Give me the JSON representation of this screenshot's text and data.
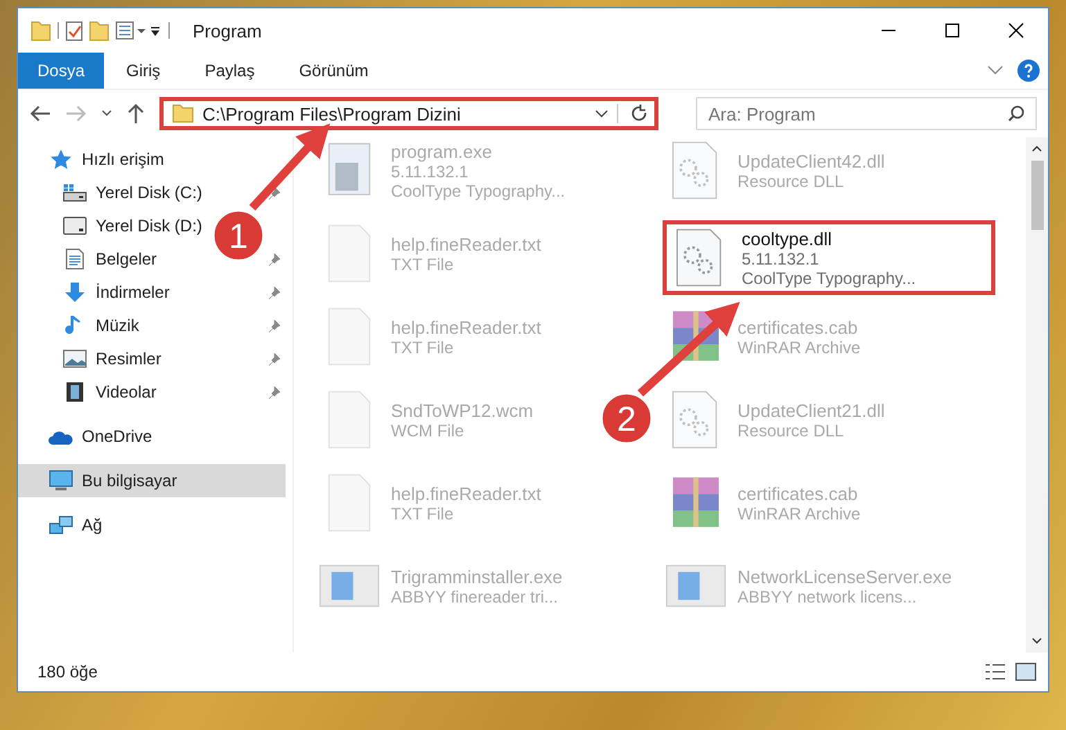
{
  "window": {
    "title": "Program",
    "controls": [
      {
        "kind": "minimize"
      },
      {
        "kind": "maximize"
      },
      {
        "kind": "close"
      }
    ]
  },
  "ribbon": {
    "tabs": [
      {
        "label": "Dosya",
        "selected": true
      },
      {
        "label": "Giriş",
        "selected": false
      },
      {
        "label": "Paylaş",
        "selected": false
      },
      {
        "label": "Görünüm",
        "selected": false
      }
    ]
  },
  "address": {
    "path": "C:\\Program Files\\Program Dizini",
    "highlighted": true
  },
  "search": {
    "placeholder": "Ara: Program"
  },
  "sidebar": {
    "items": [
      {
        "label": "Hızlı erişim",
        "kind": "star",
        "selected": false,
        "children": [
          {
            "label": "Yerel Disk (C:)",
            "kind": "system-drive",
            "pinned": true
          },
          {
            "label": "Yerel Disk (D:)",
            "kind": "drive"
          },
          {
            "label": "Belgeler",
            "kind": "document",
            "pinned": true
          },
          {
            "label": "İndirmeler",
            "kind": "download",
            "pinned": true
          },
          {
            "label": "Müzik",
            "kind": "music",
            "pinned": true
          },
          {
            "label": "Resimler",
            "kind": "pictures",
            "pinned": true
          },
          {
            "label": "Videolar",
            "kind": "video",
            "pinned": true
          }
        ]
      },
      {
        "label": "OneDrive",
        "kind": "cloud",
        "selected": false
      },
      {
        "label": "Bu bilgisayar",
        "kind": "computer",
        "selected": true
      },
      {
        "label": "Ağ",
        "kind": "network",
        "selected": false
      }
    ]
  },
  "files": [
    {
      "name": "program.exe",
      "details": [
        "5.11.132.1",
        "CoolType Typography..."
      ],
      "kind": "app",
      "faded": true,
      "highlighted": false
    },
    {
      "name": "UpdateClient42.dll",
      "details": [
        "Resource DLL"
      ],
      "kind": "dll",
      "faded": true,
      "highlighted": false
    },
    {
      "name": "help.fineReader.txt",
      "details": [
        "TXT File"
      ],
      "kind": "txt",
      "faded": true,
      "highlighted": false
    },
    {
      "name": "cooltype.dll",
      "details": [
        "5.11.132.1",
        "CoolType Typography..."
      ],
      "kind": "dll",
      "faded": false,
      "highlighted": true
    },
    {
      "name": "help.fineReader.txt",
      "details": [
        "TXT File"
      ],
      "kind": "txt",
      "faded": true,
      "highlighted": false
    },
    {
      "name": "certificates.cab",
      "details": [
        "WinRAR Archive"
      ],
      "kind": "cab",
      "faded": true,
      "highlighted": false
    },
    {
      "name": "SndToWP12.wcm",
      "details": [
        "WCM File"
      ],
      "kind": "txt",
      "faded": true,
      "highlighted": false
    },
    {
      "name": "UpdateClient21.dll",
      "details": [
        "Resource DLL"
      ],
      "kind": "dll",
      "faded": true,
      "highlighted": false
    },
    {
      "name": "help.fineReader.txt",
      "details": [
        "TXT File"
      ],
      "kind": "txt",
      "faded": true,
      "highlighted": false
    },
    {
      "name": "certificates.cab",
      "details": [
        "WinRAR Archive"
      ],
      "kind": "cab",
      "faded": true,
      "highlighted": false
    },
    {
      "name": "Trigramminstaller.exe",
      "details": [
        "ABBYY finereader tri..."
      ],
      "kind": "installer",
      "faded": true,
      "highlighted": false
    },
    {
      "name": "NetworkLicenseServer.exe",
      "details": [
        "ABBYY network licens..."
      ],
      "kind": "installer",
      "faded": true,
      "highlighted": false
    }
  ],
  "status_bar": {
    "count": "180 öğe"
  },
  "annotations": [
    {
      "number": "1"
    },
    {
      "number": "2"
    }
  ]
}
